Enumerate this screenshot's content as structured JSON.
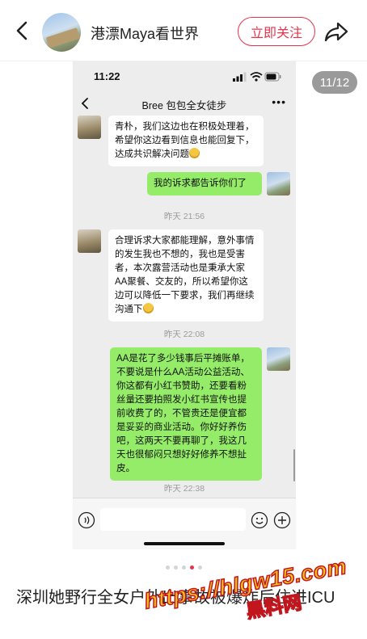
{
  "header": {
    "username": "港漂Maya看世界",
    "follow_label": "立即关注"
  },
  "gallery": {
    "counter": "11/12",
    "total_dots": 5,
    "active_dot": 3
  },
  "phone": {
    "status_time": "11:22",
    "chat_title": "Bree 包包全女徒步",
    "more_label": "•••",
    "messages": {
      "m1": {
        "from": "other",
        "text": "青朴，我们这边也在积极处理着，希望你这边看到信息也能回复下，达成共识解决问题"
      },
      "m2": {
        "from": "me",
        "text": "我的诉求都告诉你们了"
      },
      "t1": "昨天 21:56",
      "m3": {
        "from": "other",
        "text": "合理诉求大家都能理解，意外事情的发生我也不想的，我也是受害者，本次露营活动也是秉承大家AA聚餐、交友的，所以希望你这边可以降低一下要求，我们再继续沟通下"
      },
      "t2": "昨天 22:08",
      "m4": {
        "from": "me",
        "text": "AA是花了多少钱事后平摊账单，不要说是什么AA活动公益活动、你这都有小红书赞助，还要看粉丝量还要拍照发小红书宣传也提前收费了的，不管贵还是便宜都是妥妥的商业活动。你好好养伤吧，这两天不要再聊了，我这几天也很郁闷只想好好修养不想扯皮。"
      },
      "t3": "昨天 22:38"
    }
  },
  "post": {
    "title": "深圳她野行全女户外出事故被爆炸后住进ICU"
  },
  "watermark": {
    "url": "https://hlgw15.com",
    "name": "黑料网"
  },
  "colors": {
    "accent": "#e8344a",
    "my_bubble": "#95ec69",
    "chat_bg": "#ededed"
  }
}
